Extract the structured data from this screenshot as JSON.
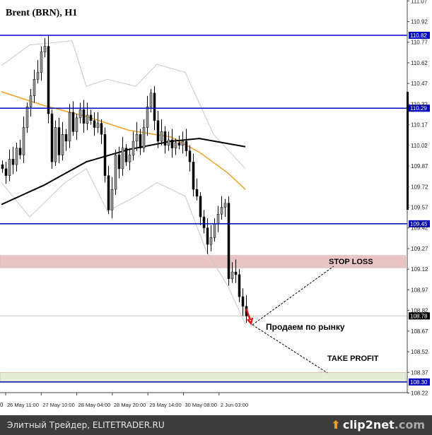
{
  "chart_data": {
    "type": "candlestick",
    "title": "Brent (BRN), H1",
    "ylim": [
      108.22,
      111.07
    ],
    "y_ticks": [
      111.07,
      110.92,
      110.77,
      110.62,
      110.47,
      110.32,
      110.17,
      110.02,
      109.87,
      109.72,
      109.57,
      109.42,
      109.27,
      109.12,
      108.97,
      108.82,
      108.67,
      108.52,
      108.37,
      108.22
    ],
    "x_ticks": [
      "26 May 11:00",
      "27 May 10:00",
      "28 May 04:00",
      "28 May 20:00",
      "29 May 14:00",
      "30 May 08:00",
      "2 Jun 03:00"
    ],
    "x_tick_left_partial": "0",
    "closes": [
      109.85,
      109.8,
      109.92,
      109.88,
      110.0,
      109.95,
      110.15,
      110.3,
      110.38,
      110.5,
      110.55,
      110.7,
      110.74,
      110.25,
      109.9,
      110.15,
      109.95,
      110.1,
      110.05,
      110.26,
      110.12,
      110.22,
      110.28,
      110.18,
      110.24,
      110.2,
      110.15,
      110.18,
      110.1,
      109.8,
      109.55,
      109.7,
      109.95,
      109.85,
      110.0,
      109.9,
      109.95,
      110.05,
      110.1,
      110.0,
      110.15,
      110.3,
      110.4,
      110.2,
      110.05,
      110.12,
      110.02,
      110.06,
      110.0,
      110.04,
      110.02,
      110.05,
      109.98,
      109.9,
      109.7,
      109.65,
      109.5,
      109.42,
      109.3,
      109.35,
      109.45,
      109.52,
      109.57,
      109.6,
      109.05,
      109.1,
      109.08,
      108.92,
      108.85,
      108.78
    ],
    "ma_long": {
      "color": "#000000",
      "points": [
        [
          0,
          109.59
        ],
        [
          12,
          109.73
        ],
        [
          24,
          109.9
        ],
        [
          36,
          109.99
        ],
        [
          48,
          110.05
        ],
        [
          56,
          110.07
        ],
        [
          69,
          110.01
        ]
      ]
    },
    "ma_short": {
      "color": "#f0a020",
      "points": [
        [
          0,
          110.41
        ],
        [
          12,
          110.31
        ],
        [
          24,
          110.23
        ],
        [
          36,
          110.13
        ],
        [
          48,
          110.08
        ],
        [
          56,
          109.97
        ],
        [
          64,
          109.82
        ],
        [
          69,
          109.7
        ]
      ]
    },
    "bb_upper": {
      "color": "#c8c8c8",
      "points": [
        [
          0,
          110.6
        ],
        [
          8,
          110.75
        ],
        [
          20,
          110.78
        ],
        [
          24,
          110.45
        ],
        [
          30,
          110.5
        ],
        [
          38,
          110.45
        ],
        [
          44,
          110.61
        ],
        [
          52,
          110.55
        ],
        [
          60,
          110.1
        ],
        [
          69,
          109.85
        ]
      ]
    },
    "bb_lower": {
      "color": "#c8c8c8",
      "points": [
        [
          0,
          109.75
        ],
        [
          8,
          109.5
        ],
        [
          18,
          109.75
        ],
        [
          24,
          109.85
        ],
        [
          30,
          109.54
        ],
        [
          38,
          109.65
        ],
        [
          44,
          109.75
        ],
        [
          52,
          109.65
        ],
        [
          58,
          109.25
        ],
        [
          64,
          109.0
        ],
        [
          69,
          108.72
        ]
      ]
    },
    "levels": [
      {
        "value": 110.82,
        "label": "110.82",
        "color": "#0000c0"
      },
      {
        "value": 110.29,
        "label": "110.29",
        "color": "#0000c0"
      },
      {
        "value": 109.45,
        "label": "109.45",
        "color": "#0000c0"
      },
      {
        "value": 108.3,
        "label": "108.30",
        "color": "#0000c0"
      }
    ],
    "current_price": {
      "value": 108.78,
      "label": "108.78"
    },
    "zones": [
      {
        "name": "stop-loss",
        "from": 109.13,
        "to": 109.22,
        "color": "#e8c4c4",
        "label": "STOP LOSS"
      },
      {
        "name": "take-profit",
        "from": 108.3,
        "to": 108.37,
        "color": "#e4edd4",
        "label": "TAKE PROFIT"
      }
    ],
    "annotation": "Продаем по рынку"
  },
  "footer": {
    "credit": "Элитный Трейдер, ELITETRADER.RU",
    "logo": "clip2net",
    "logo_suffix": ".com"
  }
}
